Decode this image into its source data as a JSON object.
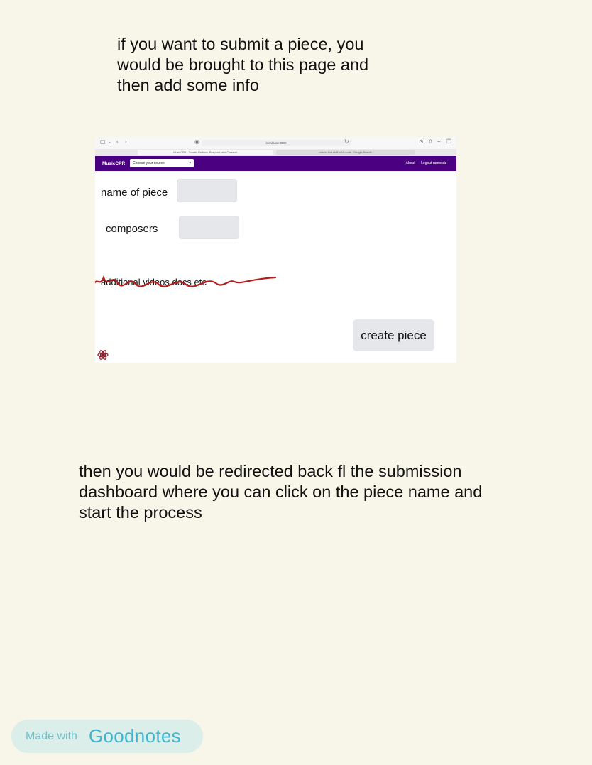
{
  "notes": {
    "top": [
      "if you want to submit a piece, you",
      "would be brought to this page and",
      "then add some info"
    ],
    "bottom": [
      "then you would be redirected back fl the submission",
      "dashboard where you can click on the piece name and",
      "start the process"
    ]
  },
  "browser": {
    "address": "localhost:3000",
    "tabs": [
      {
        "label": "MusicCPR - Create, Perform, Respond, and Connect"
      },
      {
        "label": "how to find stuff in Vs code - Google Search"
      }
    ]
  },
  "app": {
    "brand": "MusicCPR",
    "course_select": {
      "value": "Choose your course"
    },
    "nav": {
      "about": "About",
      "logout": "Logout ramosdz"
    },
    "colors": {
      "navbar": "#4b0082",
      "field": "#e5e7ea",
      "scribble": "#b31c1c"
    }
  },
  "form": {
    "name_label": "name of piece",
    "composers_label": "composers",
    "additional_label": "additional videos docs etc",
    "create_button": "create piece"
  },
  "footer": {
    "made_with": "Made with",
    "brand": "Goodnotes"
  }
}
